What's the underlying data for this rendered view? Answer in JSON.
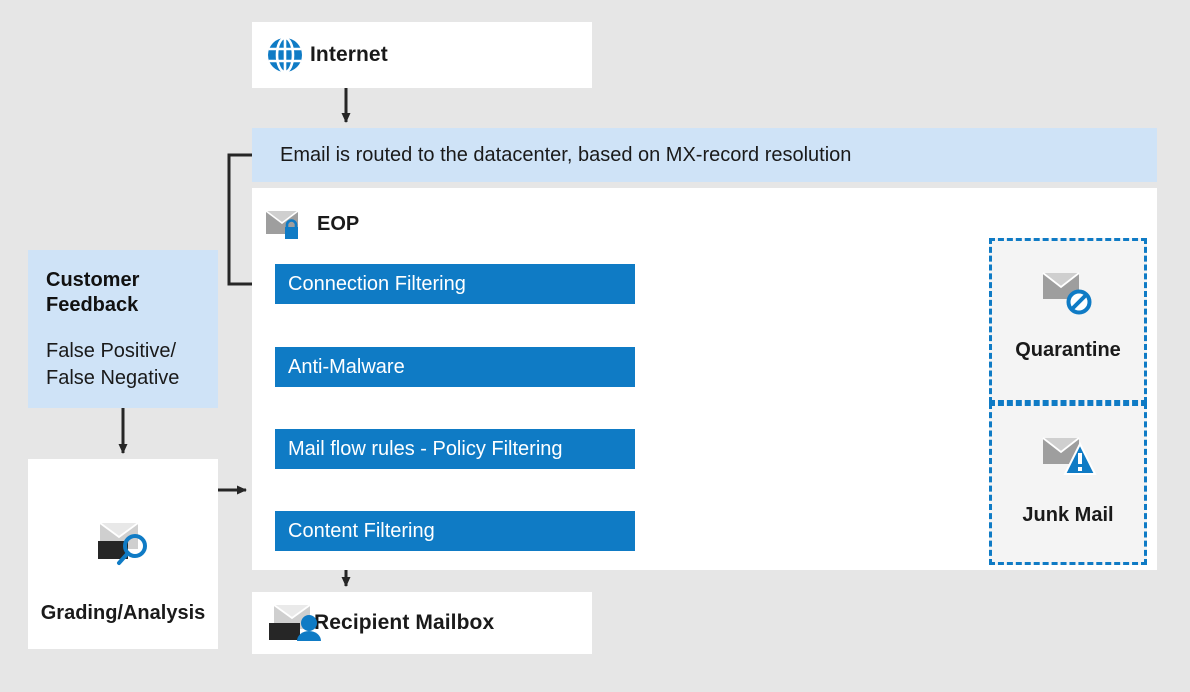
{
  "colors": {
    "background": "#e6e6e6",
    "panel": "#ffffff",
    "accent_blue": "#0f7bc5",
    "banner_blue": "#cfe3f7",
    "dash_fill": "#f4f4f4",
    "arrow_dark": "#262626",
    "icon_gray": "#9e9e9e",
    "icon_dark": "#262626",
    "text": "#1a1a1a"
  },
  "internet": {
    "label": "Internet",
    "icon": "globe-icon"
  },
  "banner": {
    "text": "Email is routed to the datacenter, based on MX-record resolution"
  },
  "eop": {
    "label": "EOP",
    "icon": "envelope-lock-icon",
    "filters": [
      {
        "label": "Connection Filtering"
      },
      {
        "label": "Anti-Malware"
      },
      {
        "label": "Mail flow rules - Policy Filtering"
      },
      {
        "label": "Content Filtering"
      }
    ]
  },
  "customer_feedback": {
    "title": "Customer Feedback",
    "title_line1": "Customer",
    "title_line2": "Feedback",
    "subtitle_line1": "False Positive/",
    "subtitle_line2": "False Negative"
  },
  "grading": {
    "label": "Grading/Analysis",
    "icon": "envelope-magnifier-icon"
  },
  "recipient": {
    "label": "Recipient Mailbox",
    "icon": "envelope-person-icon"
  },
  "outcomes": [
    {
      "label": "Quarantine",
      "icon": "envelope-blocked-icon"
    },
    {
      "label": "Junk Mail",
      "icon": "envelope-warning-icon"
    }
  ]
}
